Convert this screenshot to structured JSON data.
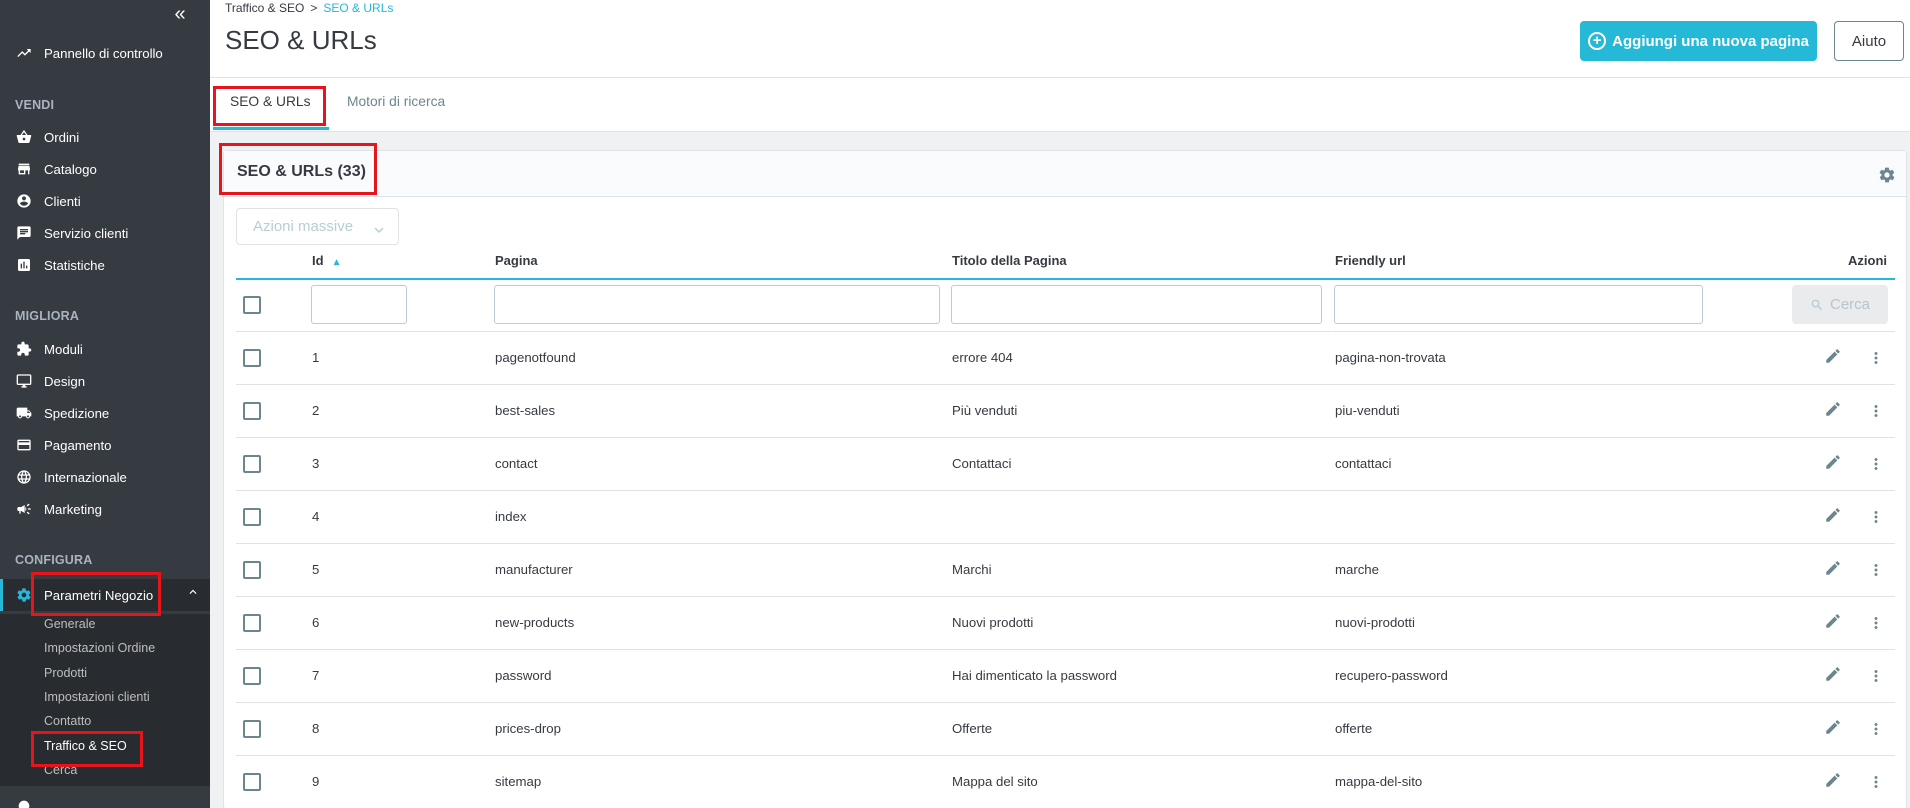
{
  "sidebar": {
    "collapse_icon": "«",
    "dashboard": "Pannello di controllo",
    "sections": {
      "sell": "VENDI",
      "improve": "MIGLIORA",
      "configure": "CONFIGURA"
    },
    "sell_items": [
      "Ordini",
      "Catalogo",
      "Clienti",
      "Servizio clienti",
      "Statistiche"
    ],
    "improve_items": [
      "Moduli",
      "Design",
      "Spedizione",
      "Pagamento",
      "Internazionale",
      "Marketing"
    ],
    "configure_active": "Parametri Negozio",
    "sub_items": [
      "Generale",
      "Impostazioni Ordine",
      "Prodotti",
      "Impostazioni clienti",
      "Contatto",
      "Traffico & SEO",
      "Cerca"
    ]
  },
  "header": {
    "breadcrumb_parent": "Traffico & SEO",
    "breadcrumb_sep": ">",
    "breadcrumb_current": "SEO & URLs",
    "title": "SEO & URLs",
    "add_button": "Aggiungi una nuova pagina",
    "help_button": "Aiuto"
  },
  "tabs": {
    "seo": "SEO & URLs",
    "search_engines": "Motori di ricerca"
  },
  "grid": {
    "title": "SEO & URLs (33)",
    "bulk_actions": "Azioni massive",
    "columns": {
      "id": "Id",
      "page": "Pagina",
      "title": "Titolo della Pagina",
      "friendly": "Friendly url",
      "actions": "Azioni"
    },
    "search_button": "Cerca",
    "rows": [
      {
        "id": "1",
        "page": "pagenotfound",
        "title": "errore 404",
        "url": "pagina-non-trovata"
      },
      {
        "id": "2",
        "page": "best-sales",
        "title": "Più venduti",
        "url": "piu-venduti"
      },
      {
        "id": "3",
        "page": "contact",
        "title": "Contattaci",
        "url": "contattaci"
      },
      {
        "id": "4",
        "page": "index",
        "title": "",
        "url": ""
      },
      {
        "id": "5",
        "page": "manufacturer",
        "title": "Marchi",
        "url": "marche"
      },
      {
        "id": "6",
        "page": "new-products",
        "title": "Nuovi prodotti",
        "url": "nuovi-prodotti"
      },
      {
        "id": "7",
        "page": "password",
        "title": "Hai dimenticato la password",
        "url": "recupero-password"
      },
      {
        "id": "8",
        "page": "prices-drop",
        "title": "Offerte",
        "url": "offerte"
      },
      {
        "id": "9",
        "page": "sitemap",
        "title": "Mappa del sito",
        "url": "mappa-del-sito"
      }
    ]
  },
  "colors": {
    "accent": "#25b9d7",
    "sidebar_bg": "#363a41",
    "highlight": "#e6141b"
  }
}
